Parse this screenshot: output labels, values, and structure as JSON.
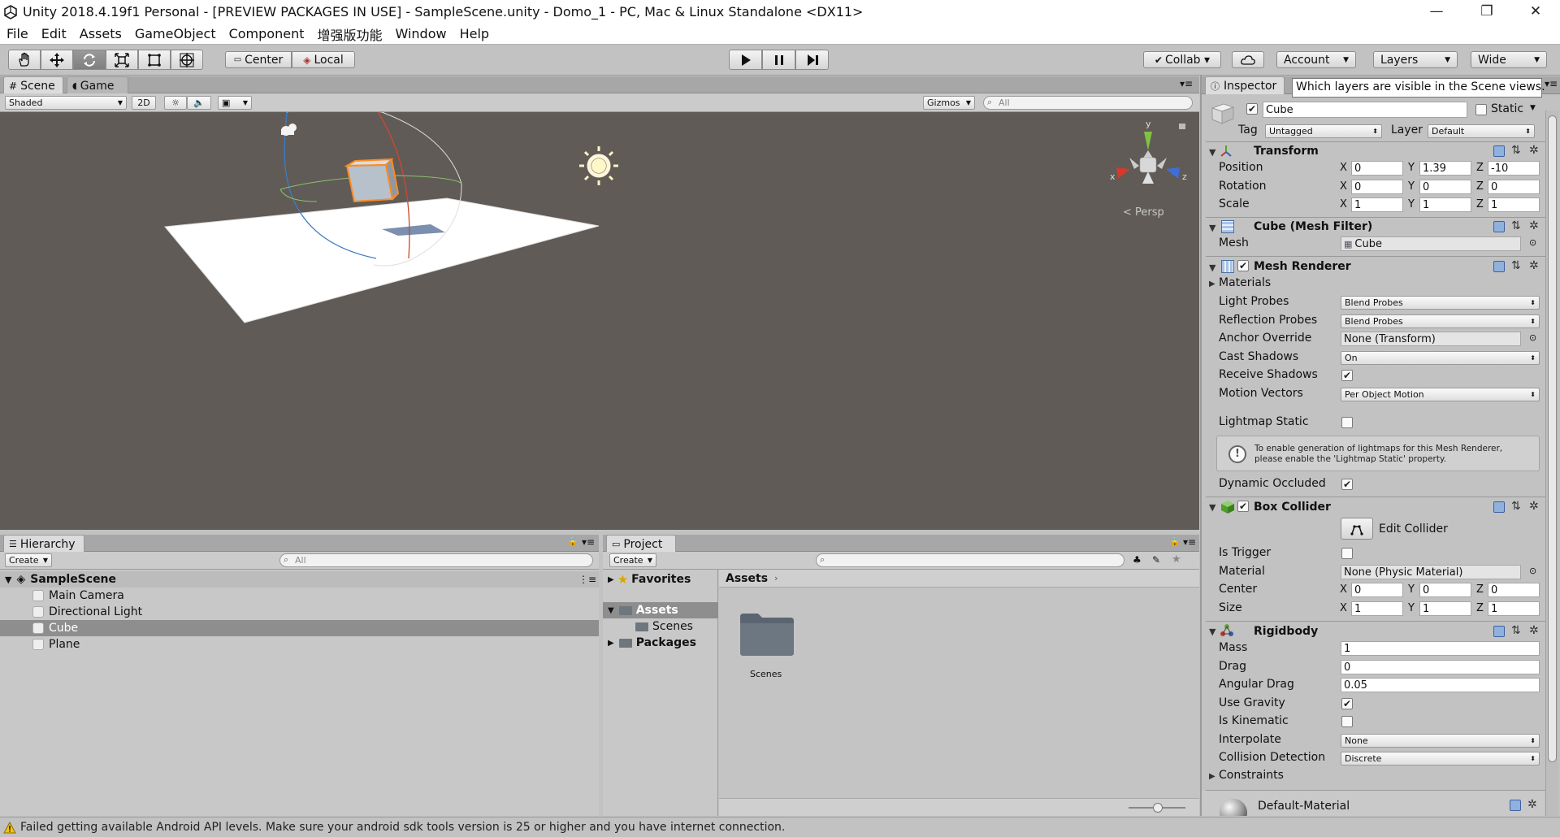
{
  "window": {
    "title": "Unity 2018.4.19f1 Personal - [PREVIEW PACKAGES IN USE] - SampleScene.unity - Domo_1 - PC, Mac & Linux Standalone <DX11>",
    "minimize": "—",
    "maximize": "❐",
    "close": "✕"
  },
  "menu": [
    "File",
    "Edit",
    "Assets",
    "GameObject",
    "Component",
    "增强版功能",
    "Window",
    "Help"
  ],
  "toolbar": {
    "pivot_center": "Center",
    "pivot_local": "Local",
    "collab": "Collab ▾",
    "account": "Account",
    "layers": "Layers",
    "layout": "Wide"
  },
  "scene_panel": {
    "tab_scene": "Scene",
    "tab_game": "Game",
    "shading": "Shaded",
    "mode_2d": "2D",
    "gizmos": "Gizmos",
    "search_placeholder": "All",
    "persp": "Persp",
    "axis_x": "x",
    "axis_y": "y",
    "axis_z": "z"
  },
  "hierarchy": {
    "tab": "Hierarchy",
    "create": "Create",
    "search_placeholder": "All",
    "scene_name": "SampleScene",
    "items": [
      "Main Camera",
      "Directional Light",
      "Cube",
      "Plane"
    ],
    "selected": "Cube"
  },
  "project": {
    "tab": "Project",
    "create": "Create",
    "favorites": "Favorites",
    "assets": "Assets",
    "scenes": "Scenes",
    "packages": "Packages",
    "breadcrumb": "Assets",
    "folder_label": "Scenes"
  },
  "inspector": {
    "tab": "Inspector",
    "tooltip": "Which layers are visible in the Scene views.",
    "object_name": "Cube",
    "static_label": "Static",
    "tag_label": "Tag",
    "tag_value": "Untagged",
    "layer_label": "Layer",
    "layer_value": "Default",
    "transform": {
      "title": "Transform",
      "position_label": "Position",
      "rotation_label": "Rotation",
      "scale_label": "Scale",
      "position": [
        "0",
        "1.39",
        "-10"
      ],
      "rotation": [
        "0",
        "0",
        "0"
      ],
      "scale": [
        "1",
        "1",
        "1"
      ]
    },
    "mesh_filter": {
      "title": "Cube (Mesh Filter)",
      "mesh_label": "Mesh",
      "mesh_value": "Cube"
    },
    "mesh_renderer": {
      "title": "Mesh Renderer",
      "materials": "Materials",
      "light_probes_label": "Light Probes",
      "light_probes": "Blend Probes",
      "reflection_probes_label": "Reflection Probes",
      "reflection_probes": "Blend Probes",
      "anchor_override_label": "Anchor Override",
      "anchor_override": "None (Transform)",
      "cast_shadows_label": "Cast Shadows",
      "cast_shadows": "On",
      "receive_shadows_label": "Receive Shadows",
      "motion_vectors_label": "Motion Vectors",
      "motion_vectors": "Per Object Motion",
      "lightmap_static_label": "Lightmap Static",
      "info_line1": "To enable generation of lightmaps for this Mesh Renderer,",
      "info_line2": "please enable the 'Lightmap Static' property.",
      "dynamic_occluded_label": "Dynamic Occluded"
    },
    "box_collider": {
      "title": "Box Collider",
      "edit_collider": "Edit Collider",
      "is_trigger_label": "Is Trigger",
      "material_label": "Material",
      "material_value": "None (Physic Material)",
      "center_label": "Center",
      "size_label": "Size",
      "center": [
        "0",
        "0",
        "0"
      ],
      "size": [
        "1",
        "1",
        "1"
      ]
    },
    "rigidbody": {
      "title": "Rigidbody",
      "mass_label": "Mass",
      "mass": "1",
      "drag_label": "Drag",
      "drag": "0",
      "angular_drag_label": "Angular Drag",
      "angular_drag": "0.05",
      "use_gravity_label": "Use Gravity",
      "is_kinematic_label": "Is Kinematic",
      "interpolate_label": "Interpolate",
      "interpolate": "None",
      "collision_detection_label": "Collision Detection",
      "collision_detection": "Discrete",
      "constraints_label": "Constraints"
    },
    "material_name": "Default-Material",
    "axis_x": "X",
    "axis_y": "Y",
    "axis_z": "Z"
  },
  "status_bar": "Failed getting available Android API levels. Make sure your android sdk tools version is 25 or higher and you have internet connection."
}
